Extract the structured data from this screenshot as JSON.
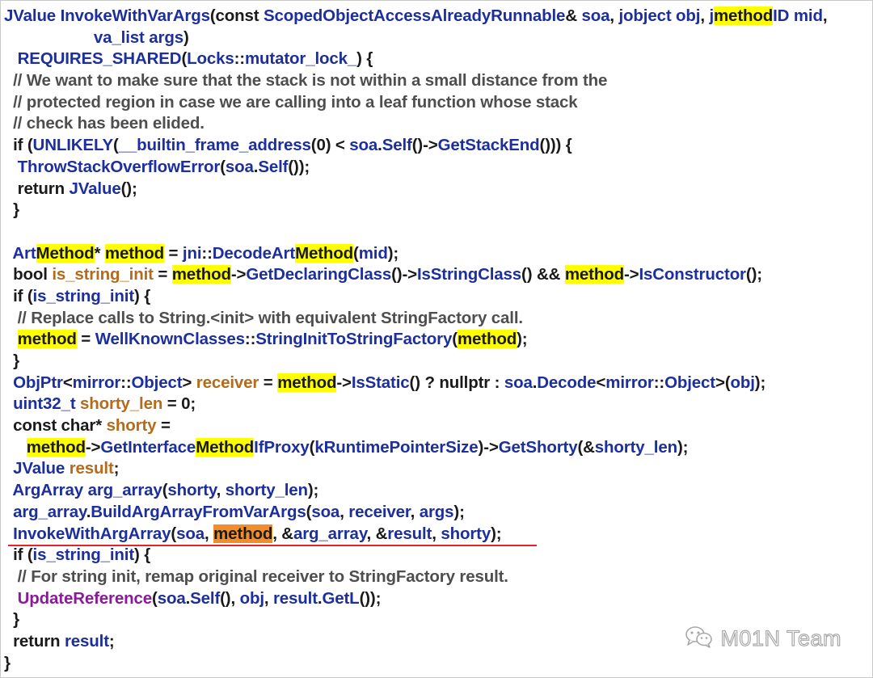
{
  "code_lines": [
    [
      {
        "text": "JValue",
        "color": "blue"
      },
      {
        "text": " InvokeWithVarArgs",
        "color": "blue"
      },
      {
        "text": "(const ",
        "color": "dark"
      },
      {
        "text": "ScopedObjectAccessAlreadyRunnable",
        "color": "blue"
      },
      {
        "text": "& ",
        "color": "dark"
      },
      {
        "text": "soa",
        "color": "blue"
      },
      {
        "text": ", ",
        "color": "dark"
      },
      {
        "text": "jobject",
        "color": "blue"
      },
      {
        "text": " ",
        "color": "dark"
      },
      {
        "text": "obj",
        "color": "blue"
      },
      {
        "text": ", ",
        "color": "dark"
      },
      {
        "text": "j",
        "color": "blue"
      },
      {
        "text": "method",
        "color": "dark",
        "hl": "yellow"
      },
      {
        "text": "ID",
        "color": "blue"
      },
      {
        "text": " ",
        "color": "dark"
      },
      {
        "text": "mid",
        "color": "blue"
      },
      {
        "text": ",",
        "color": "dark"
      }
    ],
    [
      {
        "text": "                    ",
        "color": "dark"
      },
      {
        "text": "va_list",
        "color": "blue"
      },
      {
        "text": " ",
        "color": "dark"
      },
      {
        "text": "args",
        "color": "blue"
      },
      {
        "text": ")",
        "color": "dark"
      }
    ],
    [
      {
        "text": "   ",
        "color": "dark"
      },
      {
        "text": "REQUIRES_SHARED",
        "color": "blue"
      },
      {
        "text": "(",
        "color": "dark"
      },
      {
        "text": "Locks",
        "color": "blue"
      },
      {
        "text": "::",
        "color": "dark"
      },
      {
        "text": "mutator_lock_",
        "color": "blue"
      },
      {
        "text": ") {",
        "color": "dark"
      }
    ],
    [
      {
        "text": "  // We want to make sure that the stack is not within a small distance from the",
        "color": "gray"
      }
    ],
    [
      {
        "text": "  // protected region in case we are calling into a leaf function whose stack",
        "color": "gray"
      }
    ],
    [
      {
        "text": "  // check has been elided.",
        "color": "gray"
      }
    ],
    [
      {
        "text": "  if (",
        "color": "dark"
      },
      {
        "text": "UNLIKELY",
        "color": "blue"
      },
      {
        "text": "(",
        "color": "dark"
      },
      {
        "text": "__builtin_frame_address",
        "color": "blue"
      },
      {
        "text": "(0) < ",
        "color": "dark"
      },
      {
        "text": "soa",
        "color": "blue"
      },
      {
        "text": ".",
        "color": "dark"
      },
      {
        "text": "Self",
        "color": "blue"
      },
      {
        "text": "()->",
        "color": "dark"
      },
      {
        "text": "GetStackEnd",
        "color": "blue"
      },
      {
        "text": "())) {",
        "color": "dark"
      }
    ],
    [
      {
        "text": "   ",
        "color": "dark"
      },
      {
        "text": "ThrowStackOverflowError",
        "color": "blue"
      },
      {
        "text": "(",
        "color": "dark"
      },
      {
        "text": "soa",
        "color": "blue"
      },
      {
        "text": ".",
        "color": "dark"
      },
      {
        "text": "Self",
        "color": "blue"
      },
      {
        "text": "());",
        "color": "dark"
      }
    ],
    [
      {
        "text": "   return ",
        "color": "dark"
      },
      {
        "text": "JValue",
        "color": "blue"
      },
      {
        "text": "();",
        "color": "dark"
      }
    ],
    [
      {
        "text": "  }",
        "color": "dark"
      }
    ],
    [
      {
        "text": "",
        "color": "dark"
      }
    ],
    [
      {
        "text": "  ",
        "color": "dark"
      },
      {
        "text": "Art",
        "color": "blue"
      },
      {
        "text": "Method",
        "color": "dark",
        "hl": "yellow"
      },
      {
        "text": "* ",
        "color": "dark"
      },
      {
        "text": "method",
        "color": "dark",
        "hl": "yellow"
      },
      {
        "text": " = ",
        "color": "dark"
      },
      {
        "text": "jni",
        "color": "blue"
      },
      {
        "text": "::",
        "color": "dark"
      },
      {
        "text": "DecodeArt",
        "color": "blue"
      },
      {
        "text": "Method",
        "color": "dark",
        "hl": "yellow"
      },
      {
        "text": "(",
        "color": "dark"
      },
      {
        "text": "mid",
        "color": "blue"
      },
      {
        "text": ");",
        "color": "dark"
      }
    ],
    [
      {
        "text": "  bool ",
        "color": "dark"
      },
      {
        "text": "is_string_init",
        "color": "brown"
      },
      {
        "text": " = ",
        "color": "dark"
      },
      {
        "text": "method",
        "color": "dark",
        "hl": "yellow"
      },
      {
        "text": "->",
        "color": "dark"
      },
      {
        "text": "GetDeclaringClass",
        "color": "blue"
      },
      {
        "text": "()->",
        "color": "dark"
      },
      {
        "text": "IsStringClass",
        "color": "blue"
      },
      {
        "text": "() && ",
        "color": "dark"
      },
      {
        "text": "method",
        "color": "dark",
        "hl": "yellow"
      },
      {
        "text": "->",
        "color": "dark"
      },
      {
        "text": "IsConstructor",
        "color": "blue"
      },
      {
        "text": "();",
        "color": "dark"
      }
    ],
    [
      {
        "text": "  if (",
        "color": "dark"
      },
      {
        "text": "is_string_init",
        "color": "blue"
      },
      {
        "text": ") {",
        "color": "dark"
      }
    ],
    [
      {
        "text": "   // Replace calls to String.<init> with equivalent StringFactory call.",
        "color": "gray"
      }
    ],
    [
      {
        "text": "   ",
        "color": "dark"
      },
      {
        "text": "method",
        "color": "dark",
        "hl": "yellow"
      },
      {
        "text": " = ",
        "color": "dark"
      },
      {
        "text": "WellKnownClasses",
        "color": "blue"
      },
      {
        "text": "::",
        "color": "dark"
      },
      {
        "text": "StringInitToStringFactory",
        "color": "blue"
      },
      {
        "text": "(",
        "color": "dark"
      },
      {
        "text": "method",
        "color": "dark",
        "hl": "yellow"
      },
      {
        "text": ");",
        "color": "dark"
      }
    ],
    [
      {
        "text": "  }",
        "color": "dark"
      }
    ],
    [
      {
        "text": "  ",
        "color": "dark"
      },
      {
        "text": "ObjPtr",
        "color": "blue"
      },
      {
        "text": "<",
        "color": "dark"
      },
      {
        "text": "mirror",
        "color": "blue"
      },
      {
        "text": "::",
        "color": "dark"
      },
      {
        "text": "Object",
        "color": "blue"
      },
      {
        "text": "> ",
        "color": "dark"
      },
      {
        "text": "receiver",
        "color": "brown"
      },
      {
        "text": " = ",
        "color": "dark"
      },
      {
        "text": "method",
        "color": "dark",
        "hl": "yellow"
      },
      {
        "text": "->",
        "color": "dark"
      },
      {
        "text": "IsStatic",
        "color": "blue"
      },
      {
        "text": "() ? nullptr : ",
        "color": "dark"
      },
      {
        "text": "soa",
        "color": "blue"
      },
      {
        "text": ".",
        "color": "dark"
      },
      {
        "text": "Decode",
        "color": "blue"
      },
      {
        "text": "<",
        "color": "dark"
      },
      {
        "text": "mirror",
        "color": "blue"
      },
      {
        "text": "::",
        "color": "dark"
      },
      {
        "text": "Object",
        "color": "blue"
      },
      {
        "text": ">(",
        "color": "dark"
      },
      {
        "text": "obj",
        "color": "blue"
      },
      {
        "text": ");",
        "color": "dark"
      }
    ],
    [
      {
        "text": "  ",
        "color": "dark"
      },
      {
        "text": "uint32_t",
        "color": "blue"
      },
      {
        "text": " ",
        "color": "dark"
      },
      {
        "text": "shorty_len",
        "color": "brown"
      },
      {
        "text": " = 0;",
        "color": "dark"
      }
    ],
    [
      {
        "text": "  const char* ",
        "color": "dark"
      },
      {
        "text": "shorty",
        "color": "brown"
      },
      {
        "text": " =",
        "color": "dark"
      }
    ],
    [
      {
        "text": "     ",
        "color": "dark"
      },
      {
        "text": "method",
        "color": "dark",
        "hl": "yellow"
      },
      {
        "text": "->",
        "color": "dark"
      },
      {
        "text": "GetInterface",
        "color": "blue"
      },
      {
        "text": "Method",
        "color": "dark",
        "hl": "yellow"
      },
      {
        "text": "IfProxy",
        "color": "blue"
      },
      {
        "text": "(",
        "color": "dark"
      },
      {
        "text": "kRuntimePointerSize",
        "color": "blue"
      },
      {
        "text": ")->",
        "color": "dark"
      },
      {
        "text": "GetShorty",
        "color": "blue"
      },
      {
        "text": "(&",
        "color": "dark"
      },
      {
        "text": "shorty_len",
        "color": "blue"
      },
      {
        "text": ");",
        "color": "dark"
      }
    ],
    [
      {
        "text": "  ",
        "color": "dark"
      },
      {
        "text": "JValue",
        "color": "blue"
      },
      {
        "text": " ",
        "color": "dark"
      },
      {
        "text": "result",
        "color": "brown"
      },
      {
        "text": ";",
        "color": "dark"
      }
    ],
    [
      {
        "text": "  ",
        "color": "dark"
      },
      {
        "text": "ArgArray",
        "color": "blue"
      },
      {
        "text": " ",
        "color": "dark"
      },
      {
        "text": "arg_array",
        "color": "blue"
      },
      {
        "text": "(",
        "color": "dark"
      },
      {
        "text": "shorty",
        "color": "blue"
      },
      {
        "text": ", ",
        "color": "dark"
      },
      {
        "text": "shorty_len",
        "color": "blue"
      },
      {
        "text": ");",
        "color": "dark"
      }
    ],
    [
      {
        "text": "  ",
        "color": "dark"
      },
      {
        "text": "arg_array",
        "color": "blue"
      },
      {
        "text": ".",
        "color": "dark"
      },
      {
        "text": "BuildArgArrayFromVarArgs",
        "color": "blue"
      },
      {
        "text": "(",
        "color": "dark"
      },
      {
        "text": "soa",
        "color": "blue"
      },
      {
        "text": ", ",
        "color": "dark"
      },
      {
        "text": "receiver",
        "color": "blue"
      },
      {
        "text": ", ",
        "color": "dark"
      },
      {
        "text": "args",
        "color": "blue"
      },
      {
        "text": ");",
        "color": "dark"
      }
    ],
    [
      {
        "text": "  ",
        "color": "dark"
      },
      {
        "text": "InvokeWithArgArray",
        "color": "blue"
      },
      {
        "text": "(",
        "color": "dark"
      },
      {
        "text": "soa",
        "color": "blue"
      },
      {
        "text": ", ",
        "color": "dark"
      },
      {
        "text": "method",
        "color": "dark",
        "hl": "orange"
      },
      {
        "text": ", &",
        "color": "dark"
      },
      {
        "text": "arg_array",
        "color": "blue"
      },
      {
        "text": ", &",
        "color": "dark"
      },
      {
        "text": "result",
        "color": "blue"
      },
      {
        "text": ", ",
        "color": "dark"
      },
      {
        "text": "shorty",
        "color": "blue"
      },
      {
        "text": ");",
        "color": "dark"
      }
    ],
    [
      {
        "text": "  if (",
        "color": "dark"
      },
      {
        "text": "is_string_init",
        "color": "blue"
      },
      {
        "text": ") {",
        "color": "dark"
      }
    ],
    [
      {
        "text": "   // For string init, remap original receiver to StringFactory result.",
        "color": "gray"
      }
    ],
    [
      {
        "text": "   ",
        "color": "dark"
      },
      {
        "text": "UpdateReference",
        "color": "purple"
      },
      {
        "text": "(",
        "color": "dark"
      },
      {
        "text": "soa",
        "color": "blue"
      },
      {
        "text": ".",
        "color": "dark"
      },
      {
        "text": "Self",
        "color": "blue"
      },
      {
        "text": "(), ",
        "color": "dark"
      },
      {
        "text": "obj",
        "color": "blue"
      },
      {
        "text": ", ",
        "color": "dark"
      },
      {
        "text": "result",
        "color": "blue"
      },
      {
        "text": ".",
        "color": "dark"
      },
      {
        "text": "GetL",
        "color": "blue"
      },
      {
        "text": "());",
        "color": "dark"
      }
    ],
    [
      {
        "text": "  }",
        "color": "dark"
      }
    ],
    [
      {
        "text": "  return ",
        "color": "dark"
      },
      {
        "text": "result",
        "color": "blue"
      },
      {
        "text": ";",
        "color": "dark"
      }
    ],
    [
      {
        "text": "}",
        "color": "dark"
      }
    ]
  ],
  "watermark": {
    "text": "M01N Team",
    "icon": "wechat-icon"
  },
  "colors": {
    "blue": "#1c2f9c",
    "brown": "#b46b1c",
    "gray": "#4e4e4e",
    "purple": "#8a1a9a",
    "dark": "#1a1a1a",
    "highlight_yellow": "#ffff00",
    "highlight_orange": "#f28d2c",
    "underline_red": "#e8222a"
  }
}
